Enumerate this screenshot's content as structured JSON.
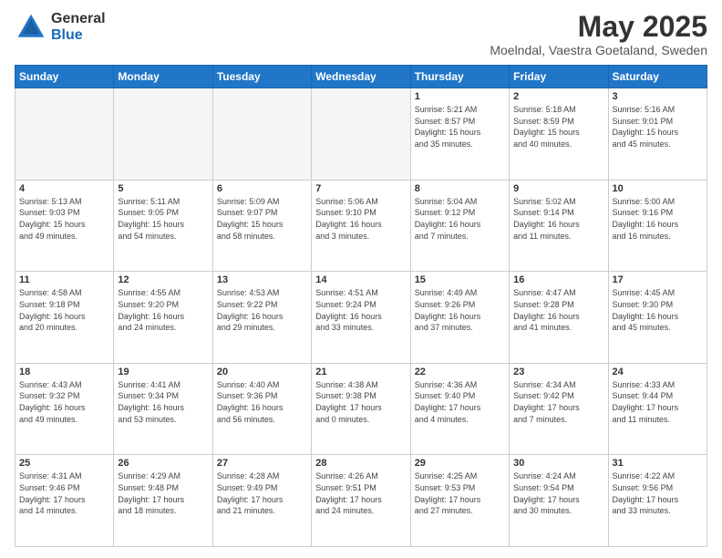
{
  "header": {
    "logo_general": "General",
    "logo_blue": "Blue",
    "month_title": "May 2025",
    "location": "Moelndal, Vaestra Goetaland, Sweden"
  },
  "weekdays": [
    "Sunday",
    "Monday",
    "Tuesday",
    "Wednesday",
    "Thursday",
    "Friday",
    "Saturday"
  ],
  "weeks": [
    [
      {
        "day": "",
        "info": ""
      },
      {
        "day": "",
        "info": ""
      },
      {
        "day": "",
        "info": ""
      },
      {
        "day": "",
        "info": ""
      },
      {
        "day": "1",
        "info": "Sunrise: 5:21 AM\nSunset: 8:57 PM\nDaylight: 15 hours\nand 35 minutes."
      },
      {
        "day": "2",
        "info": "Sunrise: 5:18 AM\nSunset: 8:59 PM\nDaylight: 15 hours\nand 40 minutes."
      },
      {
        "day": "3",
        "info": "Sunrise: 5:16 AM\nSunset: 9:01 PM\nDaylight: 15 hours\nand 45 minutes."
      }
    ],
    [
      {
        "day": "4",
        "info": "Sunrise: 5:13 AM\nSunset: 9:03 PM\nDaylight: 15 hours\nand 49 minutes."
      },
      {
        "day": "5",
        "info": "Sunrise: 5:11 AM\nSunset: 9:05 PM\nDaylight: 15 hours\nand 54 minutes."
      },
      {
        "day": "6",
        "info": "Sunrise: 5:09 AM\nSunset: 9:07 PM\nDaylight: 15 hours\nand 58 minutes."
      },
      {
        "day": "7",
        "info": "Sunrise: 5:06 AM\nSunset: 9:10 PM\nDaylight: 16 hours\nand 3 minutes."
      },
      {
        "day": "8",
        "info": "Sunrise: 5:04 AM\nSunset: 9:12 PM\nDaylight: 16 hours\nand 7 minutes."
      },
      {
        "day": "9",
        "info": "Sunrise: 5:02 AM\nSunset: 9:14 PM\nDaylight: 16 hours\nand 11 minutes."
      },
      {
        "day": "10",
        "info": "Sunrise: 5:00 AM\nSunset: 9:16 PM\nDaylight: 16 hours\nand 16 minutes."
      }
    ],
    [
      {
        "day": "11",
        "info": "Sunrise: 4:58 AM\nSunset: 9:18 PM\nDaylight: 16 hours\nand 20 minutes."
      },
      {
        "day": "12",
        "info": "Sunrise: 4:55 AM\nSunset: 9:20 PM\nDaylight: 16 hours\nand 24 minutes."
      },
      {
        "day": "13",
        "info": "Sunrise: 4:53 AM\nSunset: 9:22 PM\nDaylight: 16 hours\nand 29 minutes."
      },
      {
        "day": "14",
        "info": "Sunrise: 4:51 AM\nSunset: 9:24 PM\nDaylight: 16 hours\nand 33 minutes."
      },
      {
        "day": "15",
        "info": "Sunrise: 4:49 AM\nSunset: 9:26 PM\nDaylight: 16 hours\nand 37 minutes."
      },
      {
        "day": "16",
        "info": "Sunrise: 4:47 AM\nSunset: 9:28 PM\nDaylight: 16 hours\nand 41 minutes."
      },
      {
        "day": "17",
        "info": "Sunrise: 4:45 AM\nSunset: 9:30 PM\nDaylight: 16 hours\nand 45 minutes."
      }
    ],
    [
      {
        "day": "18",
        "info": "Sunrise: 4:43 AM\nSunset: 9:32 PM\nDaylight: 16 hours\nand 49 minutes."
      },
      {
        "day": "19",
        "info": "Sunrise: 4:41 AM\nSunset: 9:34 PM\nDaylight: 16 hours\nand 53 minutes."
      },
      {
        "day": "20",
        "info": "Sunrise: 4:40 AM\nSunset: 9:36 PM\nDaylight: 16 hours\nand 56 minutes."
      },
      {
        "day": "21",
        "info": "Sunrise: 4:38 AM\nSunset: 9:38 PM\nDaylight: 17 hours\nand 0 minutes."
      },
      {
        "day": "22",
        "info": "Sunrise: 4:36 AM\nSunset: 9:40 PM\nDaylight: 17 hours\nand 4 minutes."
      },
      {
        "day": "23",
        "info": "Sunrise: 4:34 AM\nSunset: 9:42 PM\nDaylight: 17 hours\nand 7 minutes."
      },
      {
        "day": "24",
        "info": "Sunrise: 4:33 AM\nSunset: 9:44 PM\nDaylight: 17 hours\nand 11 minutes."
      }
    ],
    [
      {
        "day": "25",
        "info": "Sunrise: 4:31 AM\nSunset: 9:46 PM\nDaylight: 17 hours\nand 14 minutes."
      },
      {
        "day": "26",
        "info": "Sunrise: 4:29 AM\nSunset: 9:48 PM\nDaylight: 17 hours\nand 18 minutes."
      },
      {
        "day": "27",
        "info": "Sunrise: 4:28 AM\nSunset: 9:49 PM\nDaylight: 17 hours\nand 21 minutes."
      },
      {
        "day": "28",
        "info": "Sunrise: 4:26 AM\nSunset: 9:51 PM\nDaylight: 17 hours\nand 24 minutes."
      },
      {
        "day": "29",
        "info": "Sunrise: 4:25 AM\nSunset: 9:53 PM\nDaylight: 17 hours\nand 27 minutes."
      },
      {
        "day": "30",
        "info": "Sunrise: 4:24 AM\nSunset: 9:54 PM\nDaylight: 17 hours\nand 30 minutes."
      },
      {
        "day": "31",
        "info": "Sunrise: 4:22 AM\nSunset: 9:56 PM\nDaylight: 17 hours\nand 33 minutes."
      }
    ]
  ]
}
